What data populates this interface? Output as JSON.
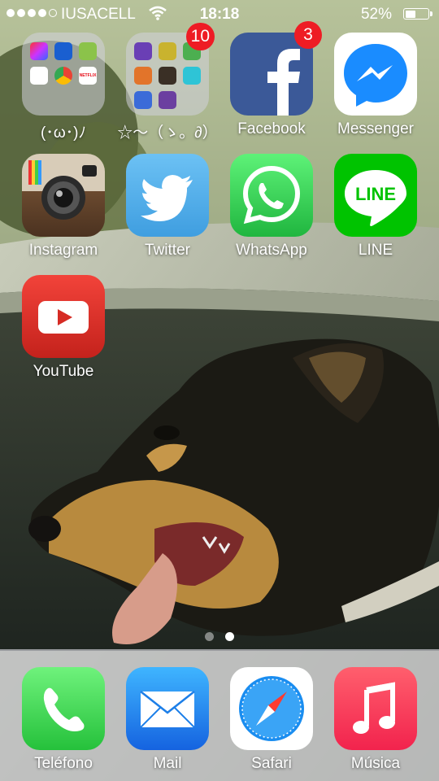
{
  "status_bar": {
    "carrier": "IUSACELL",
    "time": "18:18",
    "battery_percent": "52%",
    "battery_level": 0.52,
    "signal_bars_filled": 4,
    "signal_bars_total": 5
  },
  "apps": [
    {
      "id": "folder1",
      "label": "(･ω･)ﾉ",
      "icon": "folder-icon",
      "badge": ""
    },
    {
      "id": "folder2",
      "label": "☆〜（ゝ。∂）",
      "icon": "games-folder-icon",
      "badge": "10"
    },
    {
      "id": "facebook",
      "label": "Facebook",
      "icon": "facebook-icon",
      "badge": "3"
    },
    {
      "id": "messenger",
      "label": "Messenger",
      "icon": "messenger-icon",
      "badge": ""
    },
    {
      "id": "instagram",
      "label": "Instagram",
      "icon": "instagram-icon",
      "badge": ""
    },
    {
      "id": "twitter",
      "label": "Twitter",
      "icon": "twitter-icon",
      "badge": ""
    },
    {
      "id": "whatsapp",
      "label": "WhatsApp",
      "icon": "whatsapp-icon",
      "badge": ""
    },
    {
      "id": "line",
      "label": "LINE",
      "icon": "line-icon",
      "badge": "",
      "icon_text": "LINE"
    },
    {
      "id": "youtube",
      "label": "YouTube",
      "icon": "youtube-icon",
      "badge": ""
    }
  ],
  "folder1_apps": [
    "photos-app",
    "apps-app",
    "maps-app",
    "translate-app",
    "chrome-app",
    "netflix-app"
  ],
  "folder1_netflix_text": "NETFLIX",
  "folder2_apps": [
    "game-1",
    "game-2",
    "game-3",
    "game-4",
    "game-5",
    "game-6",
    "game-7",
    "game-8"
  ],
  "page_indicator": {
    "count": 2,
    "current": 2
  },
  "dock": [
    {
      "id": "telefono",
      "label": "Teléfono",
      "icon": "phone-icon"
    },
    {
      "id": "mail",
      "label": "Mail",
      "icon": "mail-icon"
    },
    {
      "id": "safari",
      "label": "Safari",
      "icon": "safari-icon"
    },
    {
      "id": "musica",
      "label": "Música",
      "icon": "music-icon"
    }
  ],
  "colors": {
    "badge": "#ee1c24",
    "facebook": "#3b5998",
    "messenger": "#0084ff",
    "twitter": "#55acee",
    "whatsapp": "#25d366",
    "line": "#00c300",
    "youtube": "#e52d27",
    "phone": "#4cd964",
    "mail": "#1d8cf8",
    "music": "#fc3158"
  }
}
